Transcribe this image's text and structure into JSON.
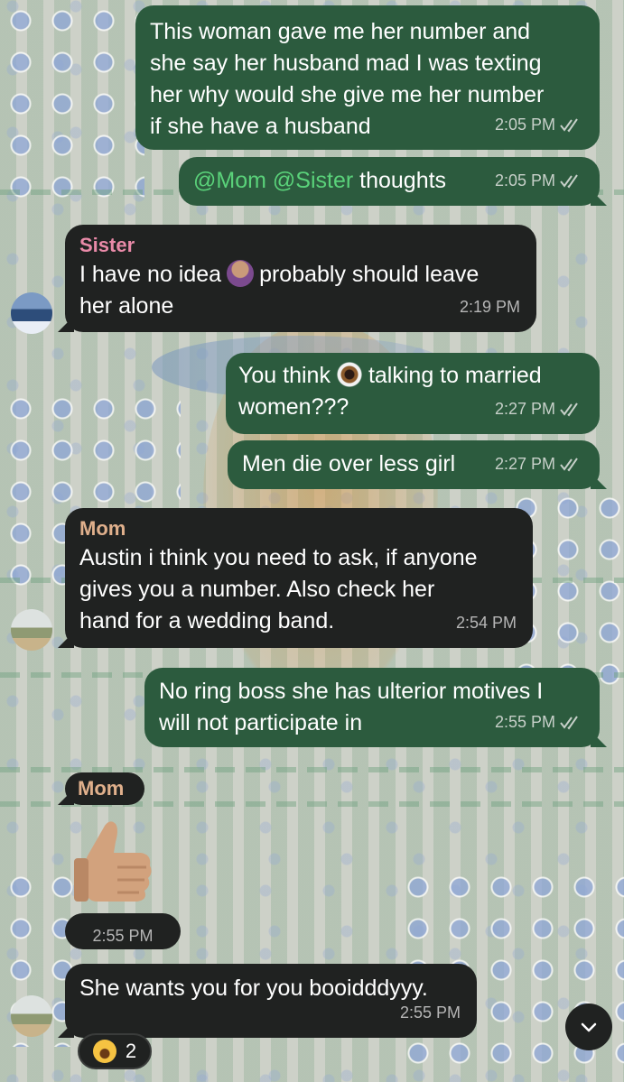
{
  "messages": [
    {
      "id": "m1",
      "text": "This woman gave me her number and\nshe say her husband mad I was texting\nher why would she give me her number\nif she have a husband",
      "time": "2:05 PM"
    },
    {
      "id": "m2",
      "mention1": "@Mom",
      "mention2": "@Sister",
      "text": " thoughts",
      "time": "2:05 PM"
    },
    {
      "id": "m3",
      "sender": "Sister",
      "text_a": "I have no idea",
      "text_b": "probably should leave\nher alone",
      "emoji": "person-shrugging-emoji",
      "time": "2:19 PM"
    },
    {
      "id": "m4",
      "text_a": "You think",
      "text_b": "talking to married\nwomen???",
      "emoji": "eye-emoji",
      "time": "2:27 PM"
    },
    {
      "id": "m5",
      "text": "Men die over less girl",
      "time": "2:27 PM"
    },
    {
      "id": "m6",
      "sender": "Mom",
      "text": "Austin i think you need to ask, if anyone\ngives you a number. Also check her\nhand for a wedding band.",
      "time": "2:54 PM"
    },
    {
      "id": "m7",
      "text": "No ring boss she has ulterior motives I\nwill not participate in",
      "time": "2:55 PM"
    },
    {
      "id": "m8",
      "sender": "Mom",
      "emoji": "thumbs-up-emoji",
      "time": "2:55 PM"
    },
    {
      "id": "m9",
      "text": "She wants you for you booidddyyy.",
      "time": "2:55 PM"
    }
  ],
  "reaction": {
    "emoji": "face-with-tears-of-joy",
    "count": "2"
  },
  "colors": {
    "outgoing": "#2c5b3e",
    "incoming": "#202221",
    "mention": "#5ad27a",
    "sister": "#e98aa8",
    "mom": "#e0b08c"
  }
}
